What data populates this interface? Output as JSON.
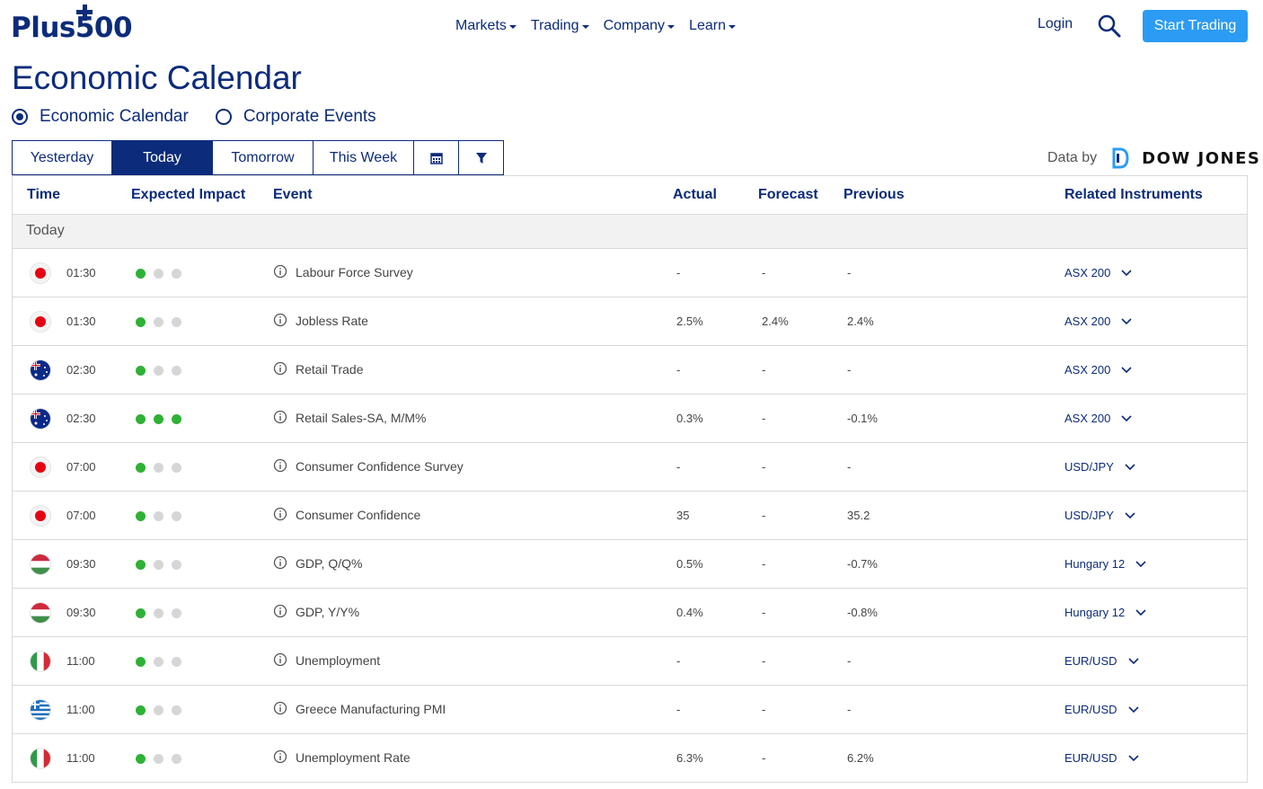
{
  "brand": {
    "logo_text": "Plus500"
  },
  "nav": {
    "items": [
      {
        "label": "Markets"
      },
      {
        "label": "Trading"
      },
      {
        "label": "Company"
      },
      {
        "label": "Learn"
      }
    ],
    "login": "Login",
    "start_trading": "Start Trading"
  },
  "page": {
    "title": "Economic Calendar"
  },
  "view_toggle": {
    "options": [
      {
        "label": "Economic Calendar",
        "selected": true
      },
      {
        "label": "Corporate Events",
        "selected": false
      }
    ]
  },
  "tabs": {
    "items": [
      {
        "label": "Yesterday",
        "active": false
      },
      {
        "label": "Today",
        "active": true
      },
      {
        "label": "Tomorrow",
        "active": false
      },
      {
        "label": "This Week",
        "active": false
      }
    ],
    "calendar_icon": "calendar-icon",
    "filter_icon": "filter-icon"
  },
  "data_provider": {
    "label": "Data by",
    "name": "DOW JONES"
  },
  "table": {
    "headers": {
      "time": "Time",
      "impact": "Expected Impact",
      "event": "Event",
      "actual": "Actual",
      "forecast": "Forecast",
      "previous": "Previous",
      "instruments": "Related Instruments"
    },
    "group_label": "Today",
    "rows": [
      {
        "flag": "japan",
        "time": "01:30",
        "impact": 1,
        "event": "Labour Force Survey",
        "actual": "-",
        "forecast": "-",
        "previous": "-",
        "instrument": "ASX 200"
      },
      {
        "flag": "japan",
        "time": "01:30",
        "impact": 1,
        "event": "Jobless Rate",
        "actual": "2.5%",
        "forecast": "2.4%",
        "previous": "2.4%",
        "instrument": "ASX 200"
      },
      {
        "flag": "australia",
        "time": "02:30",
        "impact": 1,
        "event": "Retail Trade",
        "actual": "-",
        "forecast": "-",
        "previous": "-",
        "instrument": "ASX 200"
      },
      {
        "flag": "australia",
        "time": "02:30",
        "impact": 3,
        "event": "Retail Sales-SA, M/M%",
        "actual": "0.3%",
        "forecast": "-",
        "previous": "-0.1%",
        "instrument": "ASX 200"
      },
      {
        "flag": "japan",
        "time": "07:00",
        "impact": 1,
        "event": "Consumer Confidence Survey",
        "actual": "-",
        "forecast": "-",
        "previous": "-",
        "instrument": "USD/JPY"
      },
      {
        "flag": "japan",
        "time": "07:00",
        "impact": 1,
        "event": "Consumer Confidence",
        "actual": "35",
        "forecast": "-",
        "previous": "35.2",
        "instrument": "USD/JPY"
      },
      {
        "flag": "hungary",
        "time": "09:30",
        "impact": 1,
        "event": "GDP, Q/Q%",
        "actual": "0.5%",
        "forecast": "-",
        "previous": "-0.7%",
        "instrument": "Hungary 12"
      },
      {
        "flag": "hungary",
        "time": "09:30",
        "impact": 1,
        "event": "GDP, Y/Y%",
        "actual": "0.4%",
        "forecast": "-",
        "previous": "-0.8%",
        "instrument": "Hungary 12"
      },
      {
        "flag": "italy",
        "time": "11:00",
        "impact": 1,
        "event": "Unemployment",
        "actual": "-",
        "forecast": "-",
        "previous": "-",
        "instrument": "EUR/USD"
      },
      {
        "flag": "greece",
        "time": "11:00",
        "impact": 1,
        "event": "Greece Manufacturing PMI",
        "actual": "-",
        "forecast": "-",
        "previous": "-",
        "instrument": "EUR/USD"
      },
      {
        "flag": "italy",
        "time": "11:00",
        "impact": 1,
        "event": "Unemployment Rate",
        "actual": "6.3%",
        "forecast": "-",
        "previous": "6.2%",
        "instrument": "EUR/USD"
      }
    ]
  },
  "colors": {
    "brand_navy": "#0c2b7a",
    "accent_blue": "#2b9bf4",
    "impact_on": "#2fb136",
    "impact_off": "#d6d6d6"
  }
}
